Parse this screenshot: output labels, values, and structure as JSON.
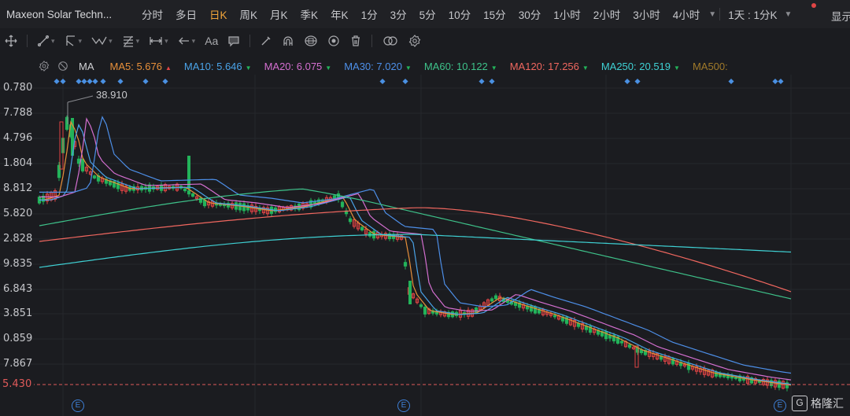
{
  "app": {
    "instrument_title": "Maxeon Solar Techn...",
    "show_label": "显示"
  },
  "timeframes": [
    {
      "label": "分时",
      "active": false
    },
    {
      "label": "多日",
      "active": false
    },
    {
      "label": "日K",
      "active": true
    },
    {
      "label": "周K",
      "active": false
    },
    {
      "label": "月K",
      "active": false
    },
    {
      "label": "季K",
      "active": false
    },
    {
      "label": "年K",
      "active": false
    },
    {
      "label": "1分",
      "active": false
    },
    {
      "label": "3分",
      "active": false
    },
    {
      "label": "5分",
      "active": false
    },
    {
      "label": "10分",
      "active": false
    },
    {
      "label": "15分",
      "active": false
    },
    {
      "label": "30分",
      "active": false
    },
    {
      "label": "1小时",
      "active": false
    },
    {
      "label": "2小时",
      "active": false
    },
    {
      "label": "3小时",
      "active": false
    },
    {
      "label": "4小时",
      "active": false
    }
  ],
  "period_combo": "1天 : 1分K",
  "toolbar_icons": [
    "crosshair-icon",
    "line-icon",
    "ray-icon",
    "polyline-icon",
    "fib-icon",
    "measure-icon",
    "arrow-icon",
    "text-icon",
    "note-icon",
    "pen-icon",
    "magnet-icon",
    "lock-icon",
    "eye-icon",
    "trash-icon",
    "link-icon",
    "settings-icon"
  ],
  "indicator": {
    "name": "MA",
    "items": [
      {
        "label": "MA5: 5.676",
        "color": "#e8903a",
        "trend": "up"
      },
      {
        "label": "MA10: 5.646",
        "color": "#4aa3e8",
        "trend": "down"
      },
      {
        "label": "MA20: 6.075",
        "color": "#d46fd0",
        "trend": "down"
      },
      {
        "label": "MA30: 7.020",
        "color": "#4d8fe8",
        "trend": "down"
      },
      {
        "label": "MA60: 10.122",
        "color": "#3ec28a",
        "trend": "down"
      },
      {
        "label": "MA120: 17.256",
        "color": "#f0675f",
        "trend": "down"
      },
      {
        "label": "MA250: 20.519",
        "color": "#3fd1d4",
        "trend": "down"
      },
      {
        "label": "MA500:",
        "color": "#a07a2a",
        "trend": ""
      }
    ]
  },
  "y_axis_labels": [
    "0.780",
    "7.788",
    "4.796",
    "1.804",
    "8.812",
    "5.820",
    "2.828",
    "9.835",
    "6.843",
    "3.851",
    "0.859",
    "7.867"
  ],
  "current_price": "5.430",
  "peak_label": "38.910",
  "watermark": "格隆汇",
  "colors": {
    "up": "#e04545",
    "down": "#23b35a",
    "accent": "#f0a43a",
    "event": "#4a90e2"
  }
}
